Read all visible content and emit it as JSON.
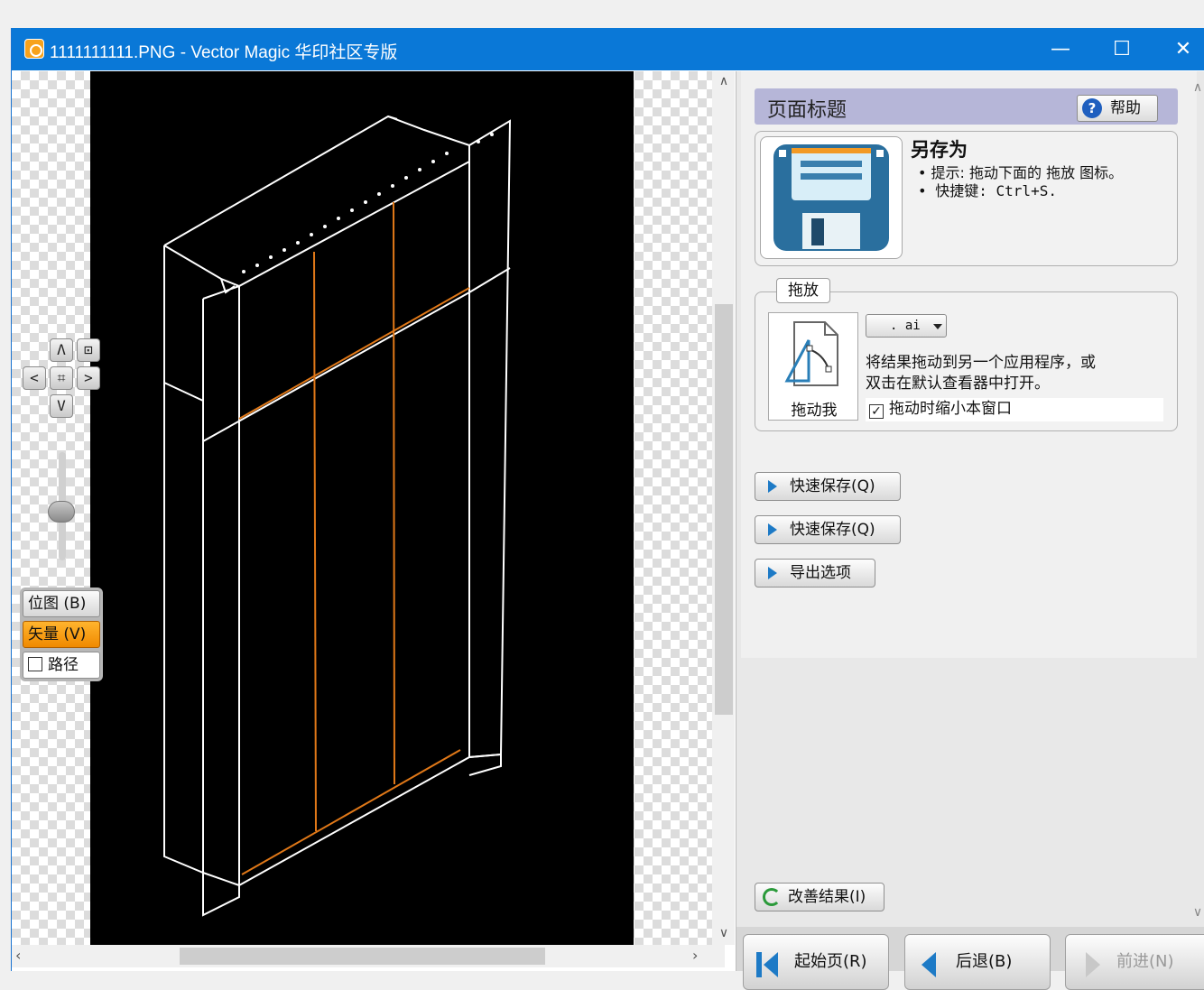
{
  "window": {
    "title": "1111111111.PNG - Vector Magic 华印社区专版",
    "minimize": "—",
    "maximize": "☐",
    "close": "✕"
  },
  "canvas": {
    "nav": {
      "up": "Λ",
      "down": "V",
      "left": "<",
      "right": ">",
      "center": "⌗",
      "fit": "⊡"
    },
    "view_modes": {
      "bitmap": "位图 (B)",
      "vector": "矢量 (V)",
      "path": "路径"
    }
  },
  "panel": {
    "page_title": "页面标题",
    "help_label": "帮助",
    "save_as": {
      "title": "另存为",
      "tip": "• 提示: 拖动下面的 拖放 图标。",
      "shortcut": "• 快捷键:  Ctrl+S."
    },
    "drag_drop": {
      "group_label": "拖放",
      "drag_me_label": "拖动我",
      "format_value": ". ai",
      "description_line1": "将结果拖动到另一个应用程序，或",
      "description_line2": "双击在默认查看器中打开。",
      "shrink_label": "拖动时缩小本窗口",
      "shrink_checked": true
    },
    "actions": [
      {
        "label": "快速保存(Q)"
      },
      {
        "label": "快速保存(Q)"
      },
      {
        "label": "导出选项"
      }
    ],
    "improve_label": "改善结果(I)",
    "bottom_nav": {
      "start": "起始页(R)",
      "back": "后退(B)",
      "forward": "前进(N)"
    }
  },
  "colors": {
    "titlebar": "#0a78d7",
    "accent_orange": "#f39a14",
    "panel_header": "#b6b6d8",
    "nav_blue": "#1d7ac6"
  }
}
